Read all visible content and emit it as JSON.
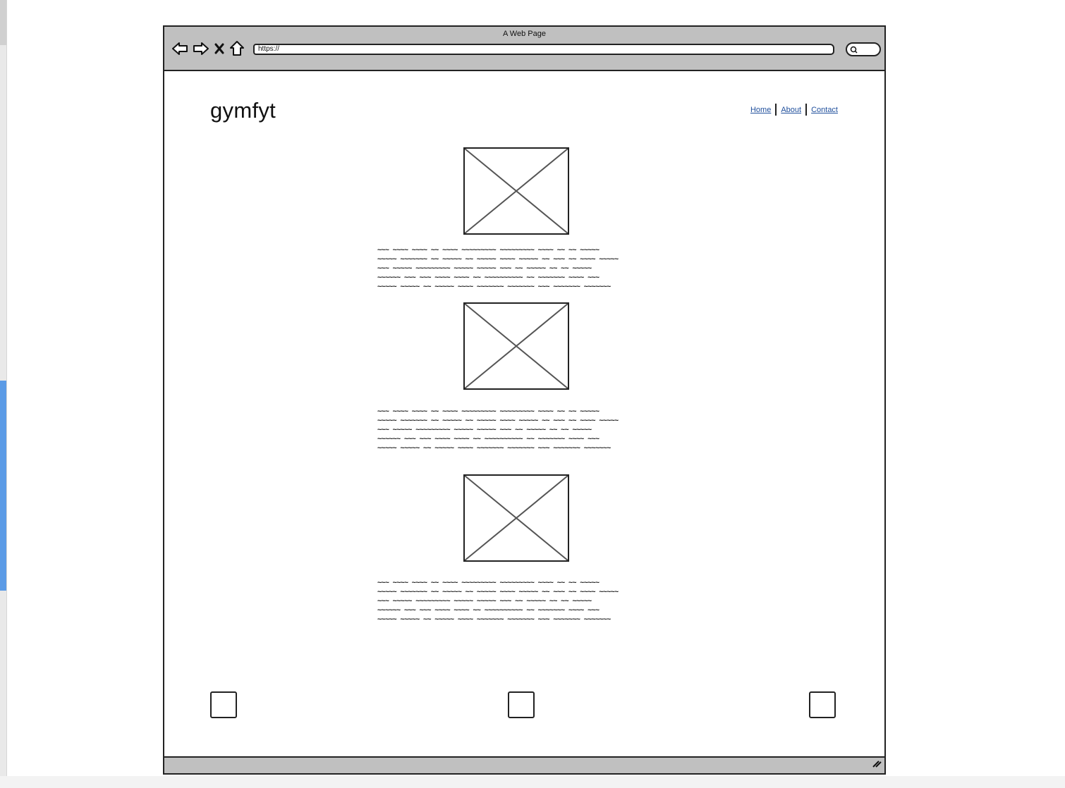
{
  "window": {
    "title": "A Web Page",
    "url": "https://"
  },
  "site": {
    "logo": "gymfyt",
    "nav": [
      "Home",
      "About",
      "Contact"
    ]
  },
  "sections": [
    {
      "image_icon": "image-placeholder-icon",
      "text_lines": [
        "~~~ ~~~~ ~~~~ ~~ ~~~~ ~~~~~~~~~ ~~~~~~~~~ ~~~~ ~~ ~~ ~~~~~",
        "~~~~~ ~~~~~~~ ~~ ~~~~~ ~~ ~~~~~ ~~~~ ~~~~~ ~~ ~~~ ~~ ~~~~ ~~~~~",
        "~~~ ~~~~~ ~~~~~~~~~ ~~~~~ ~~~~~ ~~~ ~~ ~~~~~ ~~ ~~ ~~~~~",
        "~~~~~~ ~~~ ~~~ ~~~~ ~~~~ ~~ ~~~~~~~~~~ ~~ ~~~~~~~ ~~~~ ~~~",
        "~~~~~ ~~~~~ ~~ ~~~~~ ~~~~ ~~~~~~~ ~~~~~~~ ~~~ ~~~~~~~ ~~~~~~~"
      ]
    },
    {
      "image_icon": "image-placeholder-icon",
      "text_lines": [
        "~~~ ~~~~ ~~~~ ~~ ~~~~ ~~~~~~~~~ ~~~~~~~~~ ~~~~ ~~ ~~ ~~~~~",
        "~~~~~ ~~~~~~~ ~~ ~~~~~ ~~ ~~~~~ ~~~~ ~~~~~ ~~ ~~~ ~~ ~~~~ ~~~~~",
        "~~~ ~~~~~ ~~~~~~~~~ ~~~~~ ~~~~~ ~~~ ~~ ~~~~~ ~~ ~~ ~~~~~",
        "~~~~~~ ~~~ ~~~ ~~~~ ~~~~ ~~ ~~~~~~~~~~ ~~ ~~~~~~~ ~~~~ ~~~",
        "~~~~~ ~~~~~ ~~ ~~~~~ ~~~~ ~~~~~~~ ~~~~~~~ ~~~ ~~~~~~~ ~~~~~~~"
      ]
    },
    {
      "image_icon": "image-placeholder-icon",
      "text_lines": [
        "~~~ ~~~~ ~~~~ ~~ ~~~~ ~~~~~~~~~ ~~~~~~~~~ ~~~~ ~~ ~~ ~~~~~",
        "~~~~~ ~~~~~~~ ~~ ~~~~~ ~~ ~~~~~ ~~~~ ~~~~~ ~~ ~~~ ~~ ~~~~ ~~~~~",
        "~~~ ~~~~~ ~~~~~~~~~ ~~~~~ ~~~~~ ~~~ ~~ ~~~~~ ~~ ~~ ~~~~~",
        "~~~~~~ ~~~ ~~~ ~~~~ ~~~~ ~~ ~~~~~~~~~~ ~~ ~~~~~~~ ~~~~ ~~~",
        "~~~~~ ~~~~~ ~~ ~~~~~ ~~~~ ~~~~~~~ ~~~~~~~ ~~~ ~~~~~~~ ~~~~~~~"
      ]
    }
  ],
  "icons": {
    "back": "arrow-left-icon",
    "forward": "arrow-right-icon",
    "stop": "close-icon",
    "home": "home-icon",
    "search": "search-icon",
    "resize": "resize-grip-icon"
  },
  "colors": {
    "chrome": "#c0c0c0",
    "link": "#1f4f9c",
    "accent": "#5b9be6"
  }
}
